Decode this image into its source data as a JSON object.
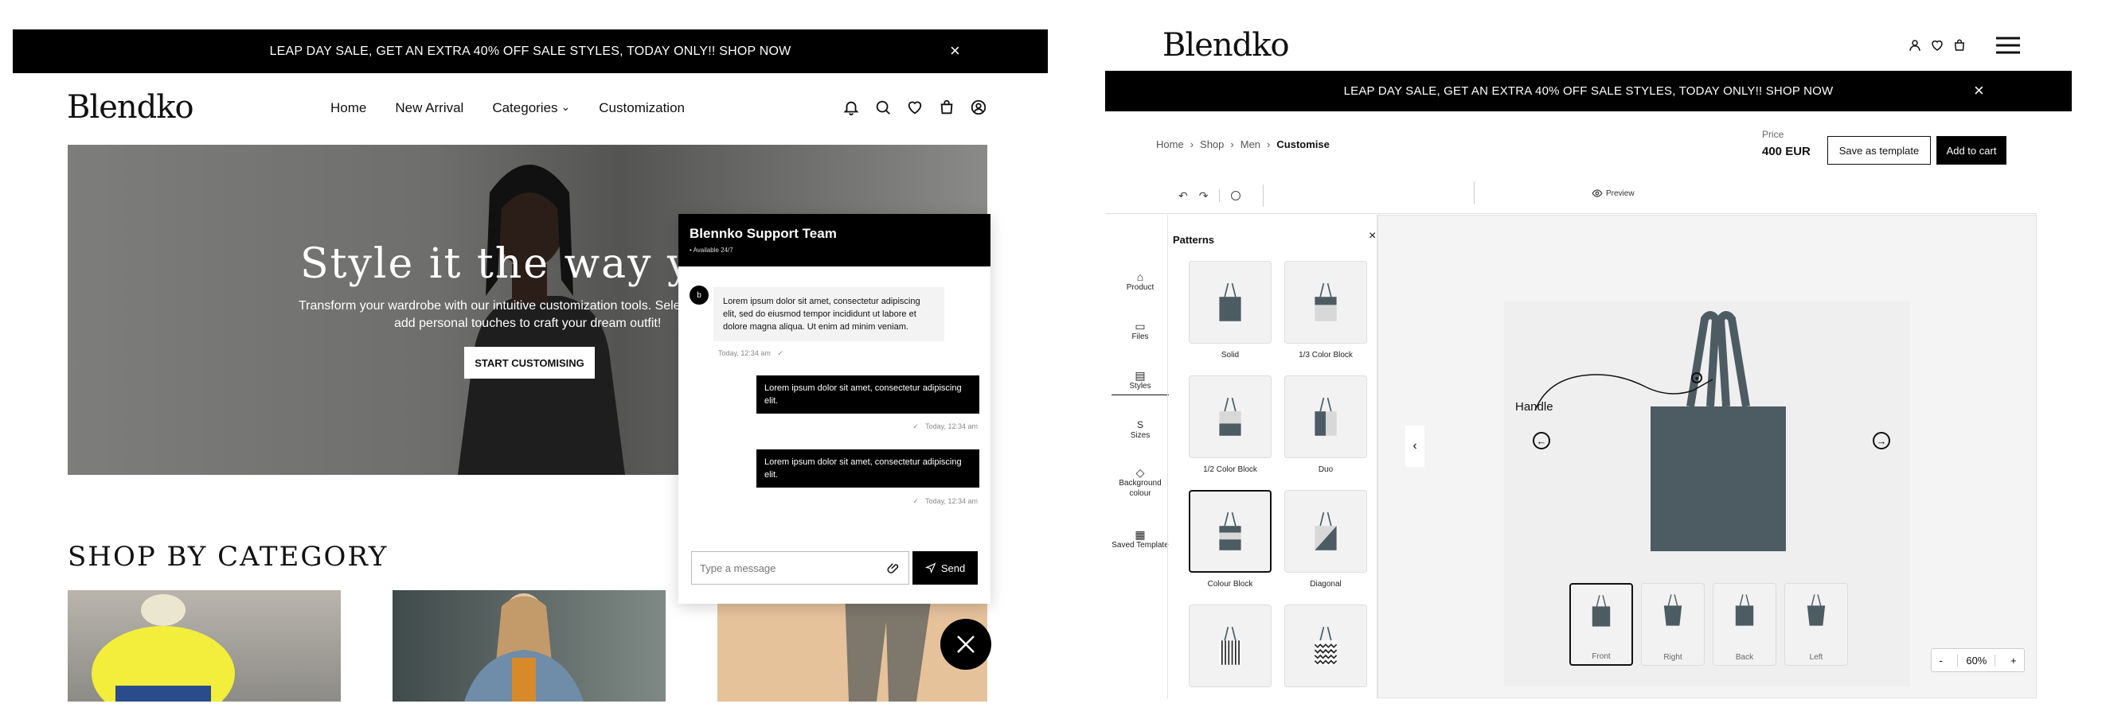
{
  "left": {
    "promo": {
      "text": "LEAP DAY SALE, GET AN EXTRA 40% OFF SALE STYLES, TODAY ONLY!! SHOP NOW",
      "close": "×"
    },
    "logo": "Blendko",
    "nav": [
      "Home",
      "New Arrival",
      "Categories",
      "Customization"
    ],
    "nav_caret": "⌄",
    "hero": {
      "title": "Style it the way you li",
      "subtitle_line1": "Transform your wardrobe with our intuitive customization tools. Sele",
      "subtitle_line2": "add personal touches to craft your dream outfit!",
      "button": "START CUSTOMISING"
    },
    "section_title": "SHOP BY CATEGORY",
    "chat": {
      "title": "Blennko Support Team",
      "status": "• Available 24/7",
      "incoming": "Lorem ipsum dolor sit amet, consectetur adipiscing elit, sed do eiusmod tempor incididunt ut labore et dolore magna aliqua. Ut enim ad minim veniam.",
      "incoming_time": "Today, 12:34 am",
      "outgoing": [
        {
          "text": "Lorem ipsum dolor sit amet, consectetur adipiscing elit.",
          "time": "Today, 12:34 am"
        },
        {
          "text": "Lorem ipsum dolor sit amet, consectetur adipiscing elit.",
          "time": "Today, 12:34 am"
        }
      ],
      "input_placeholder": "Type a message",
      "send": "Send",
      "tick": "✓"
    }
  },
  "right": {
    "logo": "Blendko",
    "promo": {
      "text": "LEAP DAY SALE, GET AN EXTRA 40% OFF SALE STYLES, TODAY ONLY!! SHOP NOW",
      "close": "×"
    },
    "breadcrumb": [
      "Home",
      "Shop",
      "Men",
      "Customise"
    ],
    "price_label": "Price",
    "price_value": "400 EUR",
    "save_template": "Save as template",
    "add_to_cart": "Add to cart",
    "preview": "Preview",
    "sidebar": [
      "Product",
      "Files",
      "Styles",
      "Sizes",
      "Background colour",
      "Saved Template"
    ],
    "panel_title": "Patterns",
    "panel_close": "×",
    "patterns": [
      "Solid",
      "1/3 Color Block",
      "1/2 Color Block",
      "Duo",
      "Colour Block",
      "Diagonal"
    ],
    "annotation": "Handle",
    "views": [
      "Front",
      "Right",
      "Back",
      "Left"
    ],
    "zoom": {
      "minus": "-",
      "value": "60%",
      "plus": "+"
    },
    "nav_prev": "‹",
    "accent": "#4d5b63"
  }
}
